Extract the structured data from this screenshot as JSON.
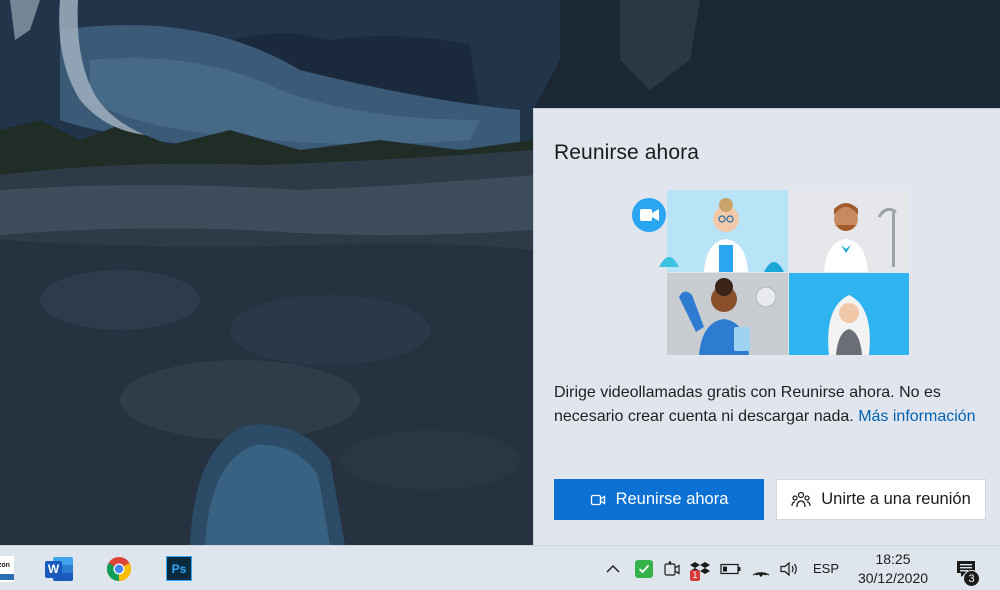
{
  "flyout": {
    "title": "Reunirse ahora",
    "description": "Dirige videollamadas gratis con Reunirse ahora. No es necesario crear cuenta ni descargar nada.",
    "more_link": "Más información",
    "primary_button": "Reunirse ahora",
    "secondary_button": "Unirte a una reunión"
  },
  "taskbar": {
    "apps": [
      {
        "name": "amazon",
        "icon": "amazon-icon",
        "label": "azon"
      },
      {
        "name": "word",
        "icon": "word-icon",
        "label": "W"
      },
      {
        "name": "chrome",
        "icon": "chrome-icon"
      },
      {
        "name": "photoshop",
        "icon": "photoshop-icon",
        "label": "Ps"
      }
    ],
    "tray": {
      "language": "ESP",
      "time": "18:25",
      "date": "30/12/2020",
      "notification_count": "3",
      "dropbox_badge": "1"
    }
  },
  "colors": {
    "accent": "#0c71d3",
    "link": "#0063b1",
    "flyout_bg": "#e1e6ee",
    "taskbar_bg": "#dfe5ec"
  }
}
